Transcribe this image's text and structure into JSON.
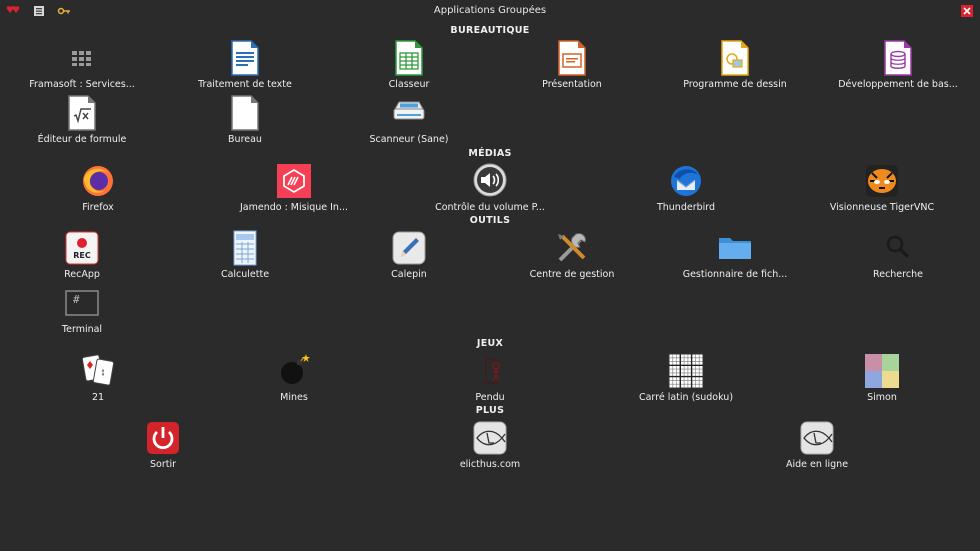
{
  "window": {
    "title": "Applications Groupées"
  },
  "sections": {
    "bureautique": "BUREAUTIQUE",
    "medias": "MÉDIAS",
    "outils": "OUTILS",
    "jeux": "JEUX",
    "plus": "PLUS"
  },
  "apps": {
    "framasoft": "Framasoft : Services...",
    "writer": "Traitement de texte",
    "calc": "Classeur",
    "impress": "Présentation",
    "draw": "Programme de dessin",
    "base": "Développement de bas...",
    "math": "Éditeur de formule",
    "bureau": "Bureau",
    "scanner": "Scanneur (Sane)",
    "firefox": "Firefox",
    "jamendo": "Jamendo : Misique In...",
    "volume": "Contrôle du volume P...",
    "thunderbird": "Thunderbird",
    "tigervnc": "Visionneuse TigerVNC",
    "recapp": "RecApp",
    "calculette": "Calculette",
    "calepin": "Calepin",
    "centre": "Centre de gestion",
    "fichiers": "Gestionnaire de fich...",
    "recherche": "Recherche",
    "terminal": "Terminal",
    "jeu21": "21",
    "mines": "Mines",
    "pendu": "Pendu",
    "sudoku": "Carré latin (sudoku)",
    "simon": "Simon",
    "sortir": "Sortir",
    "elicthus": "elicthus.com",
    "aide": "Aide en ligne"
  },
  "icon_names": {
    "rec_text": "REC",
    "terminal_text": "#"
  }
}
